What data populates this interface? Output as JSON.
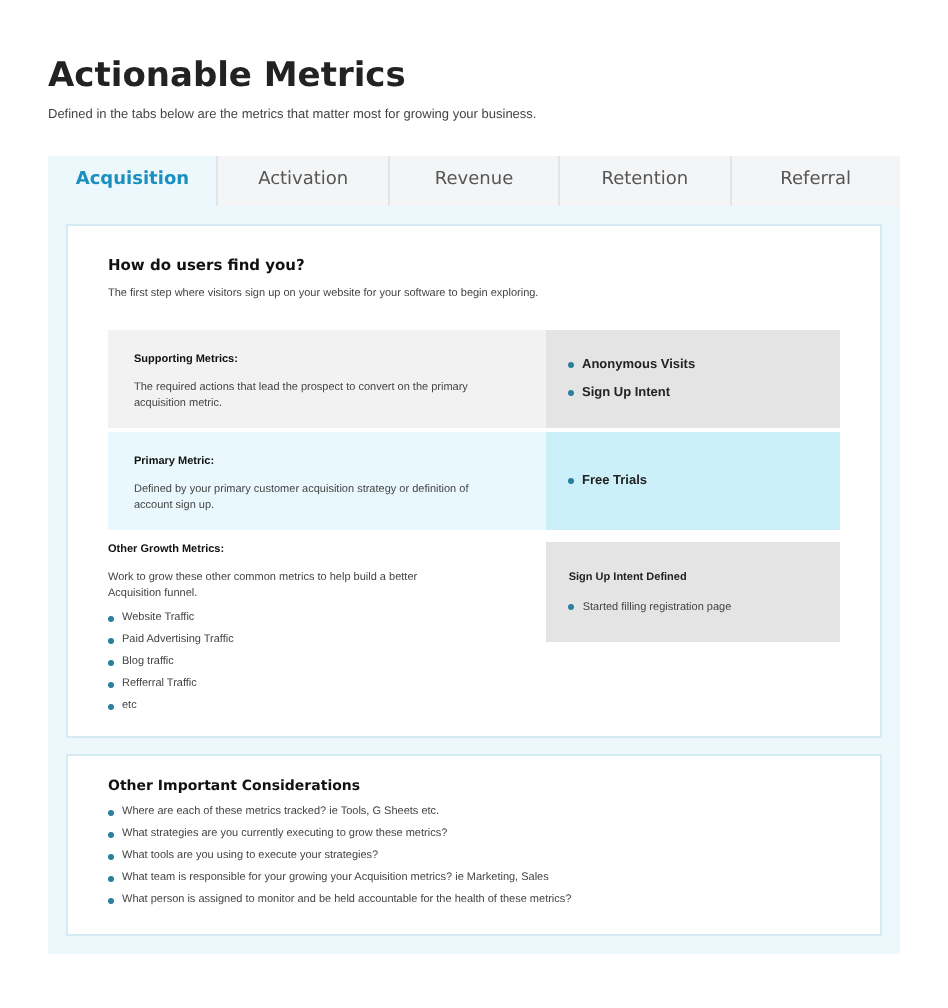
{
  "title": "Actionable Metrics",
  "subtitle": "Defined in the tabs below are the metrics that matter most for growing your business.",
  "tabs": [
    {
      "label": "Acquisition",
      "selected": true
    },
    {
      "label": "Activation",
      "selected": false
    },
    {
      "label": "Revenue",
      "selected": false
    },
    {
      "label": "Retention",
      "selected": false
    },
    {
      "label": "Referral",
      "selected": false
    }
  ],
  "section": {
    "heading": "How do users find you?",
    "description": "The first step where visitors sign up on your website for your software to begin exploring."
  },
  "metric_rows": [
    {
      "kind": "supporting",
      "label": "Supporting Metrics:",
      "description": "The required actions that lead the prospect to convert on the primary acquisition metric.",
      "items": [
        "Anonymous Visits",
        "Sign Up Intent"
      ]
    },
    {
      "kind": "primary",
      "label": "Primary Metric:",
      "description": "Defined by your primary customer acquisition strategy or definition of account sign up.",
      "items": [
        "Free Trials"
      ]
    }
  ],
  "other_growth": {
    "label": "Other Growth Metrics:",
    "description": "Work to grow these other common metrics to help build a better Acquisition funnel.",
    "items": [
      "Website Traffic",
      "Paid Advertising Traffic",
      "Blog traffic",
      "Refferral Traffic",
      "etc"
    ]
  },
  "definition": {
    "heading": "Sign Up Intent Defined",
    "items": [
      "Started filling registration page"
    ]
  },
  "considerations": {
    "heading": "Other Important Considerations",
    "items": [
      "Where are each of these metrics tracked? ie Tools, G Sheets etc.",
      "What strategies are you currently executing to grow these metrics?",
      "What tools are you using to execute your strategies?",
      "What team is responsible for your growing your Acquisition metrics? ie Marketing, Sales",
      "What person is assigned to monitor and be held accountable for the health of these metrics?"
    ]
  }
}
